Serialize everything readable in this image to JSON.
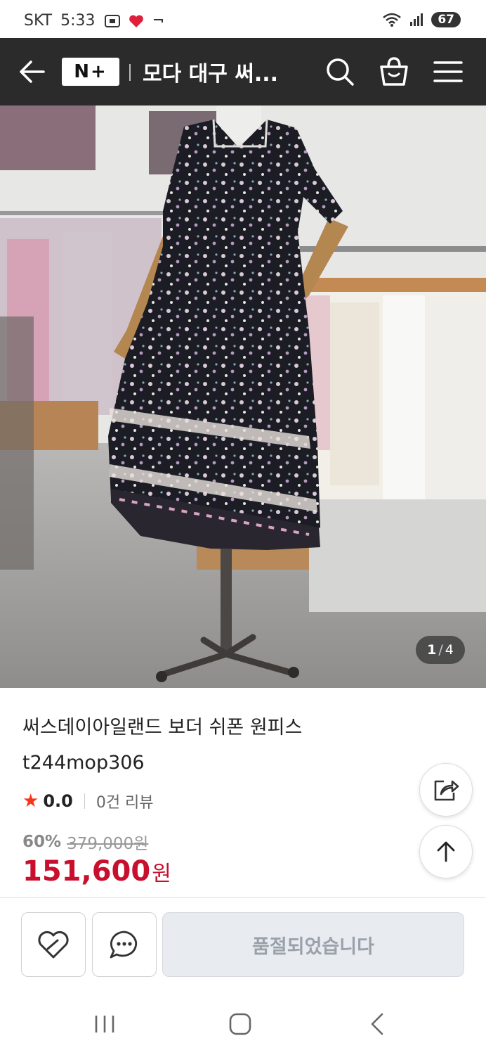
{
  "status_bar": {
    "carrier": "SKT",
    "time": "5:33",
    "battery": "67"
  },
  "header": {
    "logo_text": "N+",
    "title": "모다 대구 써...",
    "icons": [
      "back-arrow-icon",
      "search-icon",
      "shopping-bag-icon",
      "menu-icon"
    ]
  },
  "gallery": {
    "current": "1",
    "separator": "/",
    "total": "4"
  },
  "product": {
    "name": "써스데이아일랜드 보더 쉬폰 원피스 t244mop306",
    "rating": "0.0",
    "review_count": "0건 리뷰",
    "discount_rate": "60%",
    "original_price": "379,000원",
    "sale_price": "151,600",
    "sale_unit": "원"
  },
  "actions": {
    "soldout_label": "품절되었습니다",
    "icons": [
      "heart-icon",
      "chat-bubble-icon",
      "share-icon",
      "arrow-up-icon"
    ]
  },
  "colors": {
    "header_bg": "#2b2b2b",
    "price_red": "#c8102e",
    "star": "#f5361d",
    "soldout_bg": "#e8ebef"
  }
}
